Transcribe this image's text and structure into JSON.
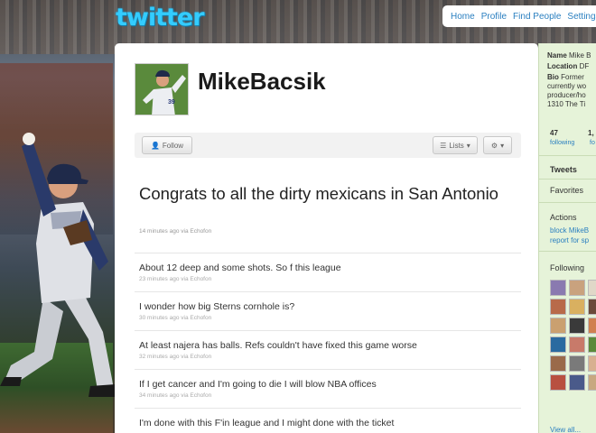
{
  "header": {
    "logo": "twitter",
    "nav": [
      "Home",
      "Profile",
      "Find People",
      "Settings"
    ]
  },
  "profile": {
    "username": "MikeBacsik",
    "follow_label": "Follow",
    "lists_label": "Lists",
    "featured_tweet": {
      "text": "Congrats to all the dirty mexicans in San Antonio",
      "meta": "14 minutes ago via Echofon"
    },
    "tweets": [
      {
        "text": "About 12 deep and some shots. So f this league",
        "meta": "23 minutes ago via Echofon"
      },
      {
        "text": "I wonder how big Sterns cornhole is?",
        "meta": "30 minutes ago via Echofon"
      },
      {
        "text": "At least najera has balls. Refs couldn't have fixed this game worse",
        "meta": "32 minutes ago via Echofon"
      },
      {
        "text": "If I get cancer and I'm going to die I will blow NBA offices",
        "meta": "34 minutes ago via Echofon"
      },
      {
        "text": "I'm done with this F'in league and I might done with the ticket",
        "meta": ""
      }
    ]
  },
  "sidebar": {
    "name_label": "Name",
    "name_value": "Mike B",
    "location_label": "Location",
    "location_value": "DF",
    "bio_label": "Bio",
    "bio_lines": [
      "Former",
      "currently wo",
      "producer/ho",
      "1310 The Ti"
    ],
    "stats": [
      {
        "count": "47",
        "label": "following"
      },
      {
        "count": "1,",
        "label": "fo"
      }
    ],
    "tweets_label": "Tweets",
    "favorites_label": "Favorites",
    "actions_label": "Actions",
    "actions_lines": [
      "block MikeB",
      "report for sp"
    ],
    "following_label": "Following",
    "view_all": "View all..."
  },
  "colors": {
    "brand": "#33ccff",
    "link": "#2a7fc0",
    "sidebar_bg": "#e6f3d9"
  }
}
